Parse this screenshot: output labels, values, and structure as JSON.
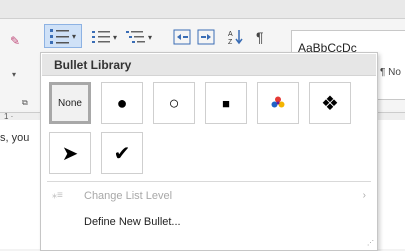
{
  "ribbon": {
    "style_preview_1": "AaBbCcDc",
    "style_preview_2": "¶ No",
    "ruler_mark": "1 ·",
    "doc_snippet": "s, you"
  },
  "panel": {
    "title": "Bullet Library",
    "cells": [
      {
        "label": "None",
        "icon": "none",
        "selected": true
      },
      {
        "glyph": "●",
        "icon": "filled-circle-bullet-icon"
      },
      {
        "glyph": "○",
        "icon": "hollow-circle-bullet-icon"
      },
      {
        "glyph": "■",
        "icon": "filled-square-bullet-icon"
      },
      {
        "glyph": "",
        "icon": "flower-bullet-icon"
      },
      {
        "glyph": "❖",
        "icon": "diamond-bullet-icon"
      },
      {
        "glyph": "➤",
        "icon": "arrowhead-bullet-icon"
      },
      {
        "glyph": "✔",
        "icon": "checkmark-bullet-icon"
      }
    ],
    "change_list_level": "Change List Level",
    "define_new_bullet": "Define New Bullet..."
  },
  "colors": {
    "active_button": "#cfe1f7",
    "icon_blue": "#3a6db5"
  }
}
